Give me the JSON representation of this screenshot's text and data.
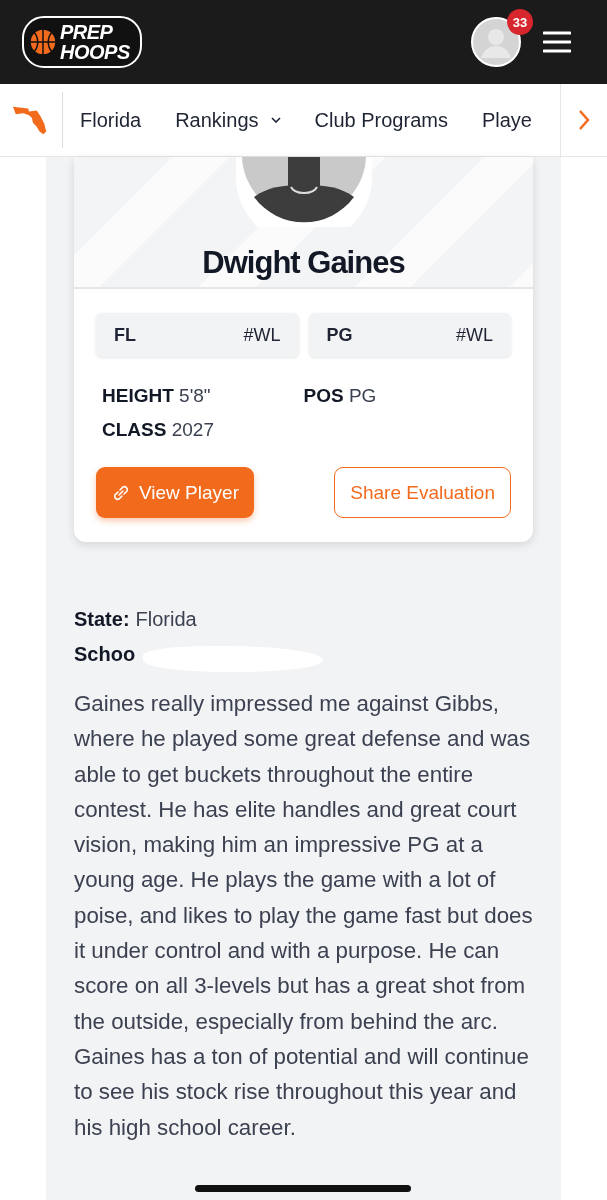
{
  "header": {
    "logo": {
      "line_1": "PREP",
      "line_2": "HOOPS"
    },
    "notifications": "33"
  },
  "nav": {
    "items": [
      {
        "label": "Florida",
        "dropdown": false
      },
      {
        "label": "Rankings",
        "dropdown": true
      },
      {
        "label": "Club Programs",
        "dropdown": false
      },
      {
        "label": "Playe",
        "dropdown": false
      }
    ]
  },
  "player": {
    "name": "Dwight Gaines",
    "chips": [
      {
        "label": "FL",
        "rank": "#WL"
      },
      {
        "label": "PG",
        "rank": "#WL"
      }
    ],
    "stats": [
      {
        "label": "HEIGHT",
        "value": "5'8\""
      },
      {
        "label": "POS",
        "value": "PG"
      },
      {
        "label": "CLASS",
        "value": "2027"
      }
    ],
    "buttons": [
      {
        "label": "View Player",
        "kind": "primary"
      },
      {
        "label": "Share Evaluation",
        "kind": "outline"
      }
    ]
  },
  "details": [
    {
      "label": "State:",
      "value": "Florida",
      "redacted": false
    },
    {
      "label": "Schoo",
      "redacted": true
    }
  ],
  "evaluation": "Gaines really impressed me against Gibbs, where he played some great defense and was able to get buckets throughout the entire contest. He has elite handles and great court vision, making him an impressive PG at a young age. He plays the game with a lot of poise, and likes to play the game fast but does it under control and with a purpose. He can score on all 3-levels but has a great shot from the outside, especially from behind the arc. Gaines has a ton of potential and will continue to see his stock rise throughout this year and his high school career."
}
